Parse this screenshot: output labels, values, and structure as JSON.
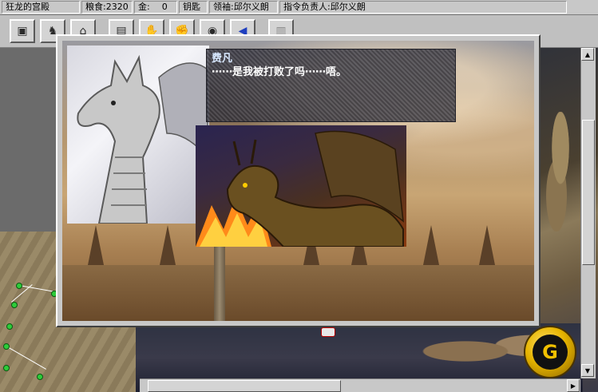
{
  "status_bar": {
    "location": "狂龙的宫殿",
    "food": "粮食:2320",
    "gold_label": "金:",
    "gold_value": "0",
    "key": "钥匙",
    "leader": "领袖:邱尔义朗",
    "commander": "指令负责人:邱尔义朗"
  },
  "toolbar": {
    "buttons": [
      {
        "icon": "map-scroll-icon",
        "glyph": "▣"
      },
      {
        "icon": "army-icon",
        "glyph": "♞"
      },
      {
        "icon": "castle-icon",
        "glyph": "⌂"
      },
      {
        "icon": "castle-gate-icon",
        "glyph": "▤"
      },
      {
        "icon": "hand-icon",
        "glyph": "✋"
      },
      {
        "icon": "shake-hands-icon",
        "glyph": "✊"
      },
      {
        "icon": "eye-icon",
        "glyph": "◉"
      },
      {
        "icon": "blue-arrow-icon",
        "glyph": "◀"
      },
      {
        "icon": "system-icon",
        "glyph": "▥"
      }
    ]
  },
  "dialog": {
    "speaker": "费凡",
    "text": "⋯⋯是我被打败了吗⋯⋯唔。"
  },
  "logo": {
    "glyph": "G"
  },
  "colors": {
    "speaker_name": "#d8e8ff",
    "path_dot": "#2ecc3a",
    "logo_gold": "#e6b400"
  }
}
